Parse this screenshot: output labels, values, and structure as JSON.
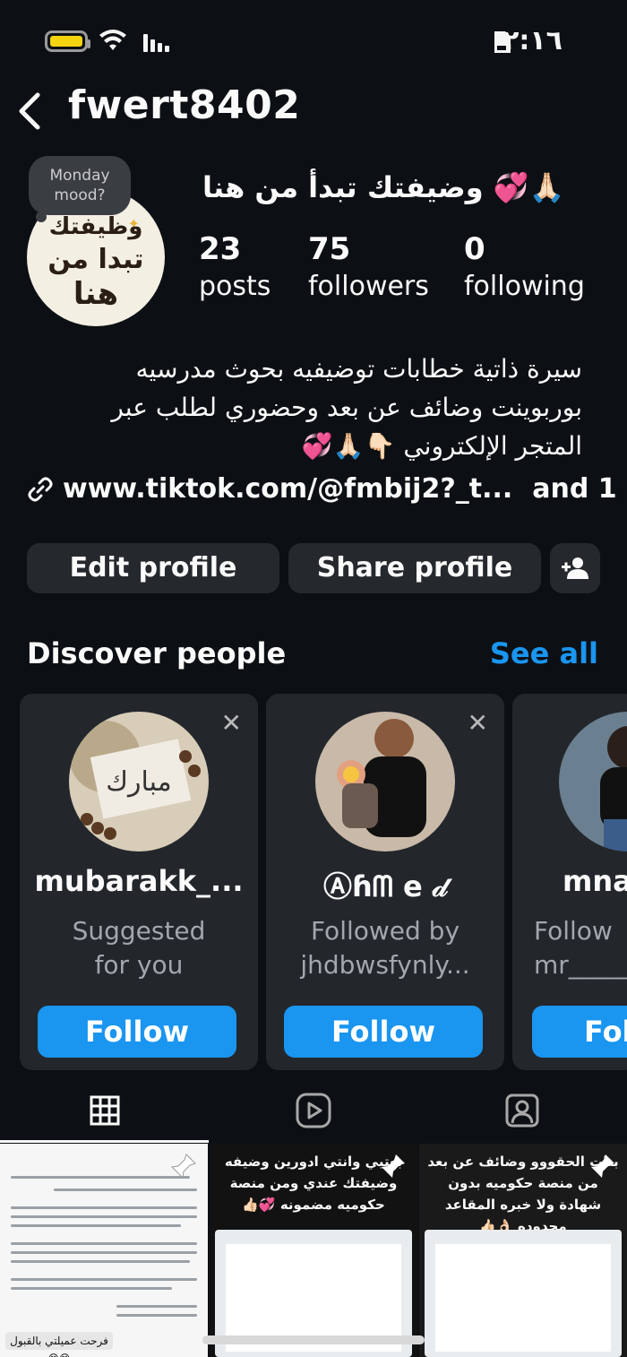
{
  "status_bar": {
    "time": "٢:١٦",
    "battery_color": "#f4d40f"
  },
  "header": {
    "username": "fwert8402"
  },
  "note": {
    "text": "Monday mood?"
  },
  "profile": {
    "display_name": "وضيفتك تبدأ من هنا 💞🙏🏻",
    "avatar_lines": [
      "وظيفتك",
      "تبدا من",
      "هنا"
    ],
    "stats": [
      {
        "value": "23",
        "label": "posts"
      },
      {
        "value": "75",
        "label": "followers"
      },
      {
        "value": "0",
        "label": "following"
      }
    ],
    "bio_lines": [
      "سيرة ذاتية خطابات توضيفيه بحوث مدرسيه",
      "بوربوينت وضائف عن بعد وحضوري لطلب عبر",
      "المتجر الإلكتروني 👇🏻🙏🏻💞"
    ],
    "link": "www.tiktok.com/@fmbij2?_t...",
    "link_more": "and 1"
  },
  "buttons": {
    "edit": "Edit profile",
    "share": "Share profile"
  },
  "discover": {
    "title": "Discover people",
    "see_all": "See all",
    "cards": [
      {
        "name": "mubarakk_...",
        "sub_lines": [
          "Suggested",
          "for you"
        ],
        "follow": "Follow",
        "avatar_icon": "prayer-beads-photo"
      },
      {
        "name": "Ⓐɦᗰ e 𝒹",
        "sub_lines": [
          "Followed by",
          "jhdbwsfynly..."
        ],
        "follow": "Follow",
        "avatar_icon": "man-holding-baby-photo"
      },
      {
        "name": "mna",
        "sub_lines": [
          "Follow",
          "mr_____"
        ],
        "follow": "Fol",
        "avatar_icon": "woman-photo"
      }
    ]
  },
  "tabs": [
    {
      "name": "grid",
      "icon": "grid-icon"
    },
    {
      "name": "reels",
      "icon": "reels-icon"
    },
    {
      "name": "tagged",
      "icon": "tagged-icon"
    }
  ],
  "posts": [
    {
      "caption": "",
      "footer": "فرحت عميلتي بالقبول 😊😊"
    },
    {
      "caption": "بعتيي وانتي ادورين وضيفه وضيفتك عندي ومن منصة حكوميه مضمونه 💞👍🏻"
    },
    {
      "caption": "بنات الحقووو وضائف عن بعد من منصة حكوميه بدون شهادة ولا خبره المقاعد محدوده 👌🏻👍🏻"
    }
  ],
  "colors": {
    "background": "#0c1014",
    "accent": "#1a95f0",
    "card": "#23272c",
    "button": "#25292e"
  }
}
